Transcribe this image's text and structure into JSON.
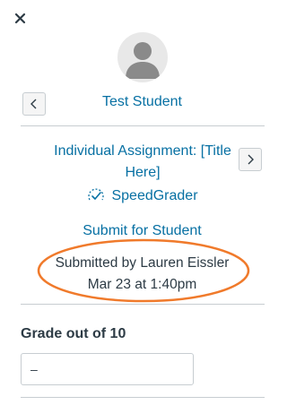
{
  "student": {
    "name": "Test Student"
  },
  "assignment": {
    "title_line1": "Individual Assignment: [Title",
    "title_line2": "Here]"
  },
  "links": {
    "speedgrader": "SpeedGrader",
    "submit_for_student": "Submit for Student"
  },
  "submission": {
    "submitted_by": "Submitted by Lauren Eissler",
    "submitted_at": "Mar 23 at 1:40pm"
  },
  "grade": {
    "label": "Grade out of 10",
    "placeholder": "–"
  },
  "icons": {
    "close": "close-icon",
    "avatar": "user-avatar",
    "prev": "chevron-left-icon",
    "next": "chevron-right-icon",
    "speedgrader": "speedgrader-icon"
  },
  "colors": {
    "link": "#0770a3",
    "highlight": "#f07a2b",
    "text": "#2d3b45"
  }
}
